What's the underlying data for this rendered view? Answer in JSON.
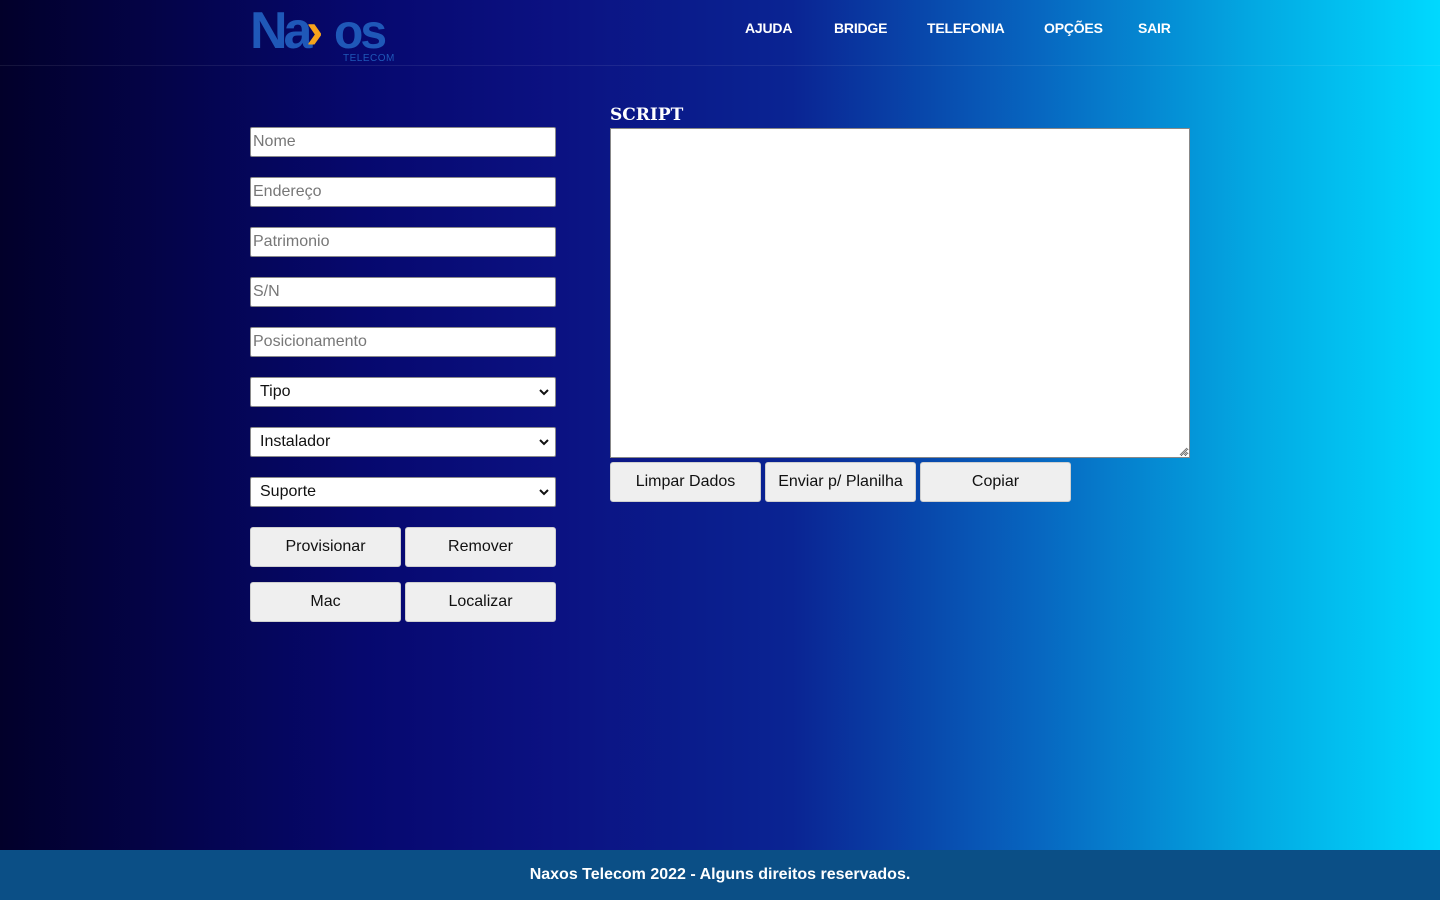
{
  "brand": {
    "logo_name": "Naxos",
    "logo_sub": "TELECOM",
    "colors": {
      "primary_blue": "#1f58b8",
      "accent_orange": "#f6a31b",
      "footer_bg": "#0b4f86"
    }
  },
  "nav": {
    "items": [
      {
        "label": "AJUDA"
      },
      {
        "label": "BRIDGE"
      },
      {
        "label": "TELEFONIA"
      },
      {
        "label": "OPÇÕES"
      },
      {
        "label": "SAIR"
      }
    ]
  },
  "form": {
    "fields": [
      {
        "placeholder": "Nome",
        "value": ""
      },
      {
        "placeholder": "Endereço",
        "value": ""
      },
      {
        "placeholder": "Patrimonio",
        "value": ""
      },
      {
        "placeholder": "S/N",
        "value": ""
      },
      {
        "placeholder": "Posicionamento",
        "value": ""
      }
    ],
    "selects": [
      {
        "selected": "Tipo",
        "icon": "chevron-down-icon"
      },
      {
        "selected": "Instalador",
        "icon": "chevron-down-icon"
      },
      {
        "selected": "Suporte",
        "icon": "chevron-down-icon"
      }
    ],
    "buttons": {
      "provisionar": "Provisionar",
      "remover": "Remover",
      "mac": "Mac",
      "localizar": "Localizar"
    }
  },
  "script": {
    "title": "SCRIPT",
    "content": "",
    "buttons": {
      "limpar": "Limpar Dados",
      "enviar": "Enviar p/ Planilha",
      "copiar": "Copiar"
    }
  },
  "footer": {
    "text": "Naxos Telecom 2022 - Alguns direitos reservados."
  }
}
